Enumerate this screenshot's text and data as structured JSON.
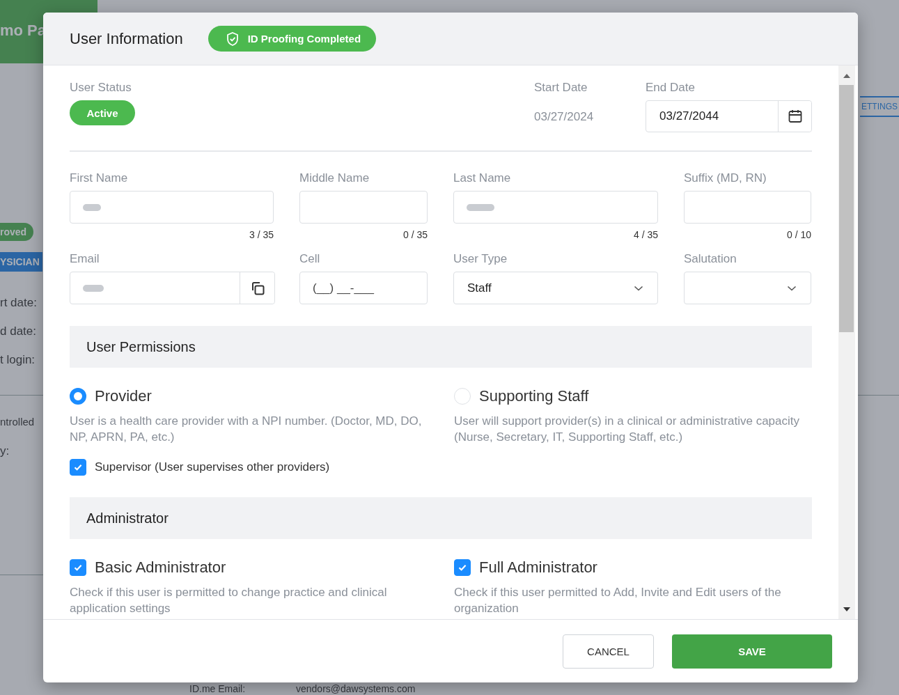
{
  "background": {
    "fragments": [
      {
        "kind": "title",
        "text": "mo Pa"
      },
      {
        "kind": "green-badge",
        "text": "roved"
      },
      {
        "kind": "blue-badge",
        "text": "YSICIAN"
      },
      {
        "kind": "label",
        "text": "rt date:"
      },
      {
        "kind": "label",
        "text": "d date:"
      },
      {
        "kind": "label",
        "text": "t login:"
      },
      {
        "kind": "label",
        "text": "ntrolled"
      },
      {
        "kind": "label",
        "text": "y:"
      },
      {
        "kind": "tab",
        "text": "ETTINGS"
      },
      {
        "kind": "label",
        "text": "ID.me Email:"
      },
      {
        "kind": "label",
        "text": "vendors@dawsystems.com"
      }
    ]
  },
  "dialog": {
    "title": "User Information",
    "proofing_badge": "ID Proofing Completed",
    "user_status": {
      "label": "User Status",
      "value": "Active"
    },
    "start_date": {
      "label": "Start Date",
      "value": "03/27/2024"
    },
    "end_date": {
      "label": "End Date",
      "value": "03/27/2044"
    },
    "fields": [
      {
        "kind": "text",
        "label": "First Name",
        "redacted": true,
        "counter": "3 / 35"
      },
      {
        "kind": "text",
        "label": "Middle Name",
        "counter": "0 / 35"
      },
      {
        "kind": "text",
        "label": "Last Name",
        "redacted": true,
        "counter": "4 / 35"
      },
      {
        "kind": "text",
        "label": "Suffix (MD, RN)",
        "counter": "0 / 10"
      },
      {
        "kind": "email",
        "label": "Email",
        "redacted": true
      },
      {
        "kind": "phone",
        "label": "Cell",
        "placeholder": "(__) __-___"
      },
      {
        "kind": "select",
        "label": "User Type",
        "value": "Staff"
      },
      {
        "kind": "select",
        "label": "Salutation"
      }
    ],
    "sections": [
      {
        "title": "User Permissions",
        "options": [
          {
            "kind": "radio",
            "label": "Provider",
            "selected": true,
            "description": "User is a health care provider with a NPI number. (Doctor, MD, DO, NP, APRN, PA, etc.)"
          },
          {
            "kind": "radio",
            "label": "Supporting Staff",
            "selected": false,
            "description": "User will support provider(s) in a clinical or administrative capacity (Nurse, Secretary, IT, Supporting Staff, etc.)"
          }
        ],
        "sub_options": [
          {
            "label": "Supervisor (User supervises other providers)",
            "checked": true
          }
        ]
      },
      {
        "title": "Administrator",
        "options": [
          {
            "kind": "checkbox",
            "label": "Basic Administrator",
            "checked": true,
            "description": "Check if this user is permitted to change practice and clinical application settings"
          },
          {
            "kind": "checkbox",
            "label": "Full Administrator",
            "checked": true,
            "description": "Check if this user permitted to Add, Invite and Edit users of the organization"
          }
        ]
      }
    ],
    "buttons": [
      {
        "kind": "secondary",
        "label": "CANCEL"
      },
      {
        "kind": "primary",
        "label": "SAVE"
      }
    ]
  }
}
